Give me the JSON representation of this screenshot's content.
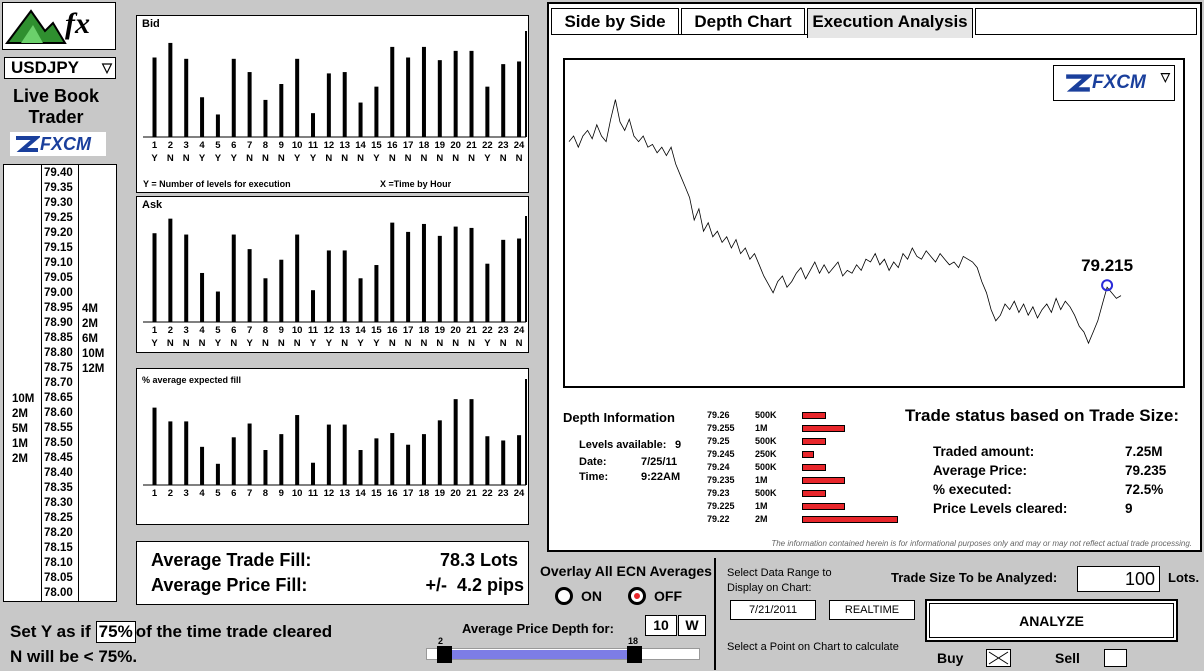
{
  "brand": {
    "logo_text": "fx",
    "badge_text": "FXCM"
  },
  "pair_select": {
    "value": "USDJPY",
    "arrow": "▽"
  },
  "live_book": {
    "title_line1": "Live Book",
    "title_line2": "Trader"
  },
  "ladder": {
    "prices": [
      "79.40",
      "79.35",
      "79.30",
      "79.25",
      "79.20",
      "79.15",
      "79.10",
      "79.05",
      "79.00",
      "78.95",
      "78.90",
      "78.85",
      "78.80",
      "78.75",
      "78.70",
      "78.65",
      "78.60",
      "78.55",
      "78.50",
      "78.45",
      "78.40",
      "78.35",
      "78.30",
      "78.25",
      "78.20",
      "78.15",
      "78.10",
      "78.05",
      "78.00"
    ],
    "ask_volumes": [
      "4M",
      "2M",
      "6M",
      "10M",
      "12M"
    ],
    "bid_volumes": [
      "10M",
      "2M",
      "5M",
      "1M",
      "2M"
    ]
  },
  "bid_chart": {
    "title": "Bid",
    "x_note": "X =Time by Hour",
    "y_note": "Y = Number of levels for execution"
  },
  "ask_chart": {
    "title": "Ask"
  },
  "fill_chart": {
    "title": "% average expected fill"
  },
  "chart_data": [
    {
      "type": "bar",
      "title": "Bid",
      "categories": [
        "1",
        "2",
        "3",
        "4",
        "5",
        "6",
        "7",
        "8",
        "9",
        "10",
        "11",
        "12",
        "13",
        "14",
        "15",
        "16",
        "17",
        "18",
        "19",
        "20",
        "21",
        "22",
        "23",
        "24"
      ],
      "values": [
        6,
        7.1,
        5.9,
        3,
        1.7,
        5.9,
        4.9,
        2.8,
        4,
        5.9,
        1.8,
        4.8,
        4.9,
        2.6,
        3.8,
        6.8,
        6,
        6.8,
        5.8,
        6.5,
        6.5,
        3.8,
        5.5,
        5.7
      ],
      "flags": [
        "Y",
        "N",
        "N",
        "Y",
        "Y",
        "Y",
        "N",
        "N",
        "N",
        "Y",
        "Y",
        "N",
        "N",
        "N",
        "Y",
        "N",
        "N",
        "N",
        "N",
        "N",
        "N",
        "Y",
        "N",
        "N"
      ],
      "ylim": [
        0,
        8
      ],
      "yticks": [
        "1",
        "2",
        "3",
        "4",
        "5",
        "6",
        "7",
        "8"
      ]
    },
    {
      "type": "bar",
      "title": "Ask",
      "categories": [
        "1",
        "2",
        "3",
        "4",
        "5",
        "6",
        "7",
        "8",
        "9",
        "10",
        "11",
        "12",
        "13",
        "14",
        "15",
        "16",
        "17",
        "18",
        "19",
        "20",
        "21",
        "22",
        "23",
        "24"
      ],
      "values": [
        6.7,
        7.8,
        6.6,
        3.7,
        2.3,
        6.6,
        5.5,
        3.3,
        4.7,
        6.6,
        2.4,
        5.4,
        5.4,
        3.3,
        4.3,
        7.5,
        6.8,
        7.4,
        6.5,
        7.2,
        7.1,
        4.4,
        6.2,
        6.3
      ],
      "flags": [
        "Y",
        "N",
        "N",
        "N",
        "Y",
        "N",
        "Y",
        "N",
        "N",
        "N",
        "Y",
        "Y",
        "N",
        "Y",
        "Y",
        "N",
        "N",
        "N",
        "N",
        "N",
        "N",
        "Y",
        "N",
        "N"
      ],
      "ylim": [
        0,
        8
      ],
      "yticks": [
        "1",
        "2",
        "3",
        "4",
        "5",
        "6",
        "7",
        "8"
      ]
    },
    {
      "type": "bar",
      "title": "% average expected fill",
      "categories": [
        "1",
        "2",
        "3",
        "4",
        "5",
        "6",
        "7",
        "8",
        "9",
        "10",
        "11",
        "12",
        "13",
        "14",
        "15",
        "16",
        "17",
        "18",
        "19",
        "20",
        "21",
        "22",
        "23",
        "24"
      ],
      "values": [
        73,
        60,
        60,
        36,
        20,
        45,
        58,
        33,
        48,
        66,
        21,
        57,
        57,
        33,
        44,
        49,
        38,
        48,
        61,
        81,
        81,
        46,
        42,
        47
      ],
      "ylim": [
        0,
        100
      ],
      "yticks": [
        "0",
        "25",
        "50",
        "75",
        "100"
      ]
    },
    {
      "type": "line",
      "series": [
        {
          "values": [
            78.78,
            78.8,
            78.76,
            78.8,
            78.82,
            78.79,
            78.84,
            78.8,
            78.78,
            78.86,
            78.93,
            78.85,
            78.82,
            78.86,
            78.8,
            78.78,
            78.8,
            78.76,
            78.77,
            78.74,
            78.76,
            78.73,
            78.76,
            78.7,
            78.66,
            78.62,
            78.58,
            78.5,
            78.54,
            78.46,
            78.49,
            78.44,
            78.46,
            78.42,
            78.44,
            78.4,
            78.43,
            78.38,
            78.4,
            78.36,
            78.38,
            78.34,
            78.3,
            78.27,
            78.24,
            78.28,
            78.3,
            78.26,
            78.28,
            78.31,
            78.33,
            78.29,
            78.32,
            78.35,
            78.31,
            78.34,
            78.31,
            78.33,
            78.35,
            78.3,
            78.32,
            78.31,
            78.34,
            78.32,
            78.36,
            78.35,
            78.38,
            78.34,
            78.36,
            78.32,
            78.35,
            78.33,
            78.38,
            78.36,
            78.4,
            78.37,
            78.36,
            78.39,
            78.37,
            78.35,
            78.38,
            78.36,
            78.34,
            78.35,
            78.33,
            78.37,
            78.36,
            78.35,
            78.33,
            78.28,
            78.24,
            78.18,
            78.14,
            78.16,
            78.2,
            78.18,
            78.21,
            78.17,
            78.2,
            78.16,
            78.19,
            78.15,
            78.18,
            78.2,
            78.17,
            78.22,
            78.18,
            78.21,
            78.19,
            78.16,
            78.12,
            78.1,
            78.06,
            78.1,
            78.14,
            78.2,
            78.26,
            78.24,
            78.22,
            78.23
          ]
        }
      ],
      "marker_label": "79.215"
    }
  ],
  "tabs": [
    {
      "label": "Side by Side"
    },
    {
      "label": "Depth Chart"
    },
    {
      "label": "Execution Analysis"
    }
  ],
  "depth_info": {
    "title": "Depth Information",
    "levels_label": "Levels available:",
    "levels_value": "9",
    "date_label": "Date:",
    "date_value": "7/25/11",
    "time_label": "Time:",
    "time_value": "9:22AM",
    "rows": [
      {
        "price": "79.26",
        "size": "500K",
        "bar": 0.25
      },
      {
        "price": "79.255",
        "size": "1M",
        "bar": 0.45
      },
      {
        "price": "79.25",
        "size": "500K",
        "bar": 0.25
      },
      {
        "price": "79.245",
        "size": "250K",
        "bar": 0.12
      },
      {
        "price": "79.24",
        "size": "500K",
        "bar": 0.25
      },
      {
        "price": "79.235",
        "size": "1M",
        "bar": 0.45
      },
      {
        "price": "79.23",
        "size": "500K",
        "bar": 0.25
      },
      {
        "price": "79.225",
        "size": "1M",
        "bar": 0.45
      },
      {
        "price": "79.22",
        "size": "2M",
        "bar": 1.0
      }
    ]
  },
  "trade_status": {
    "title": "Trade status based on Trade Size:",
    "rows": [
      {
        "label": "Traded amount:",
        "value": "7.25M"
      },
      {
        "label": "Average Price:",
        "value": "79.235"
      },
      {
        "label": "% executed:",
        "value": "72.5%"
      },
      {
        "label": "Price Levels cleared:",
        "value": "9"
      }
    ]
  },
  "disclaimer": "The information contained herein is for informational purposes only and may or may not reflect actual trade processing.",
  "averages": {
    "trade_fill_label": "Average Trade Fill:",
    "trade_fill_value": "78.3 Lots",
    "price_fill_label": "Average Price Fill:",
    "price_fill_value": "+/-  4.2 pips"
  },
  "threshold": {
    "prefix": "Set Y as if",
    "value": "75%",
    "suffix": "of the time trade cleared",
    "line2": "N will be < 75%."
  },
  "overlay": {
    "title": "Overlay All ECN Averages",
    "on_label": "ON",
    "off_label": "OFF",
    "selected": "OFF"
  },
  "depth_slider": {
    "label": "Average Price Depth for:",
    "value": "10",
    "unit": "W",
    "min_label": "2",
    "max_label": "18"
  },
  "date_range": {
    "label_line1": "Select Data Range to",
    "label_line2": "Display on Chart:",
    "start": "7/21/2011",
    "end": "REALTIME",
    "hint": "Select a Point on Chart to calculate"
  },
  "trade_size": {
    "label": "Trade Size To be Analyzed:",
    "value": "100",
    "unit": "Lots."
  },
  "analyze_button": "ANALYZE",
  "buy_label": "Buy",
  "sell_label": "Sell"
}
